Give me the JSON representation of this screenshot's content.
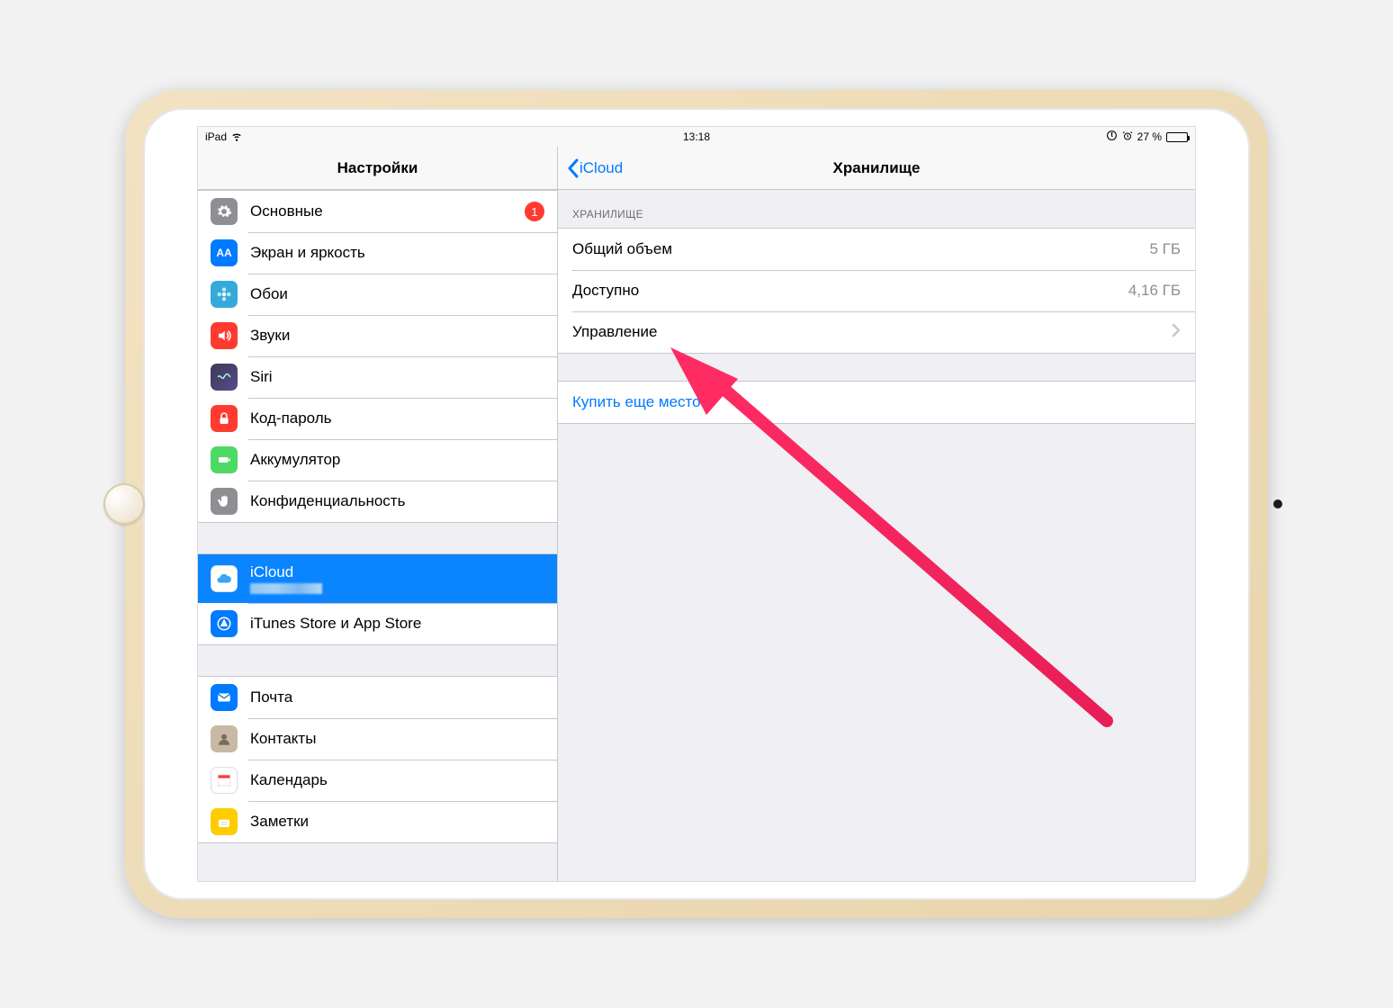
{
  "statusbar": {
    "device": "iPad",
    "time": "13:18",
    "battery_pct": "27 %",
    "lock": "⊕",
    "alarm": "⏰"
  },
  "sidebar_title": "Настройки",
  "sidebar": {
    "group1": [
      {
        "label": "Основные",
        "badge": "1",
        "icon": "gear",
        "bg": "bg-gray"
      },
      {
        "label": "Экран и яркость",
        "icon": "brightness",
        "bg": "bg-blue"
      },
      {
        "label": "Обои",
        "icon": "flower",
        "bg": "bg-cyan"
      },
      {
        "label": "Звуки",
        "icon": "speaker",
        "bg": "bg-red"
      },
      {
        "label": "Siri",
        "icon": "siri",
        "bg": "bg-siri"
      },
      {
        "label": "Код-пароль",
        "icon": "lock",
        "bg": "bg-red"
      },
      {
        "label": "Аккумулятор",
        "icon": "battery",
        "bg": "bg-green"
      },
      {
        "label": "Конфиденциальность",
        "icon": "hand",
        "bg": "bg-darkgray"
      }
    ],
    "group2": [
      {
        "label": "iCloud",
        "icon": "cloud",
        "bg": "bg-white",
        "selected": true,
        "twoline": true
      },
      {
        "label": "iTunes Store и App Store",
        "icon": "appstore",
        "bg": "bg-blue"
      }
    ],
    "group3": [
      {
        "label": "Почта",
        "icon": "mail",
        "bg": "bg-blue"
      },
      {
        "label": "Контакты",
        "icon": "contacts",
        "bg": "bg-darkgray"
      },
      {
        "label": "Календарь",
        "icon": "calendar",
        "bg": "bg-white"
      },
      {
        "label": "Заметки",
        "icon": "notes",
        "bg": "bg-yellow"
      }
    ]
  },
  "detail": {
    "back": "iCloud",
    "title": "Хранилище",
    "section": "ХРАНИЛИЩЕ",
    "rows": {
      "total_label": "Общий объем",
      "total_value": "5 ГБ",
      "avail_label": "Доступно",
      "avail_value": "4,16 ГБ",
      "manage_label": "Управление"
    },
    "buy_more": "Купить еще место"
  }
}
